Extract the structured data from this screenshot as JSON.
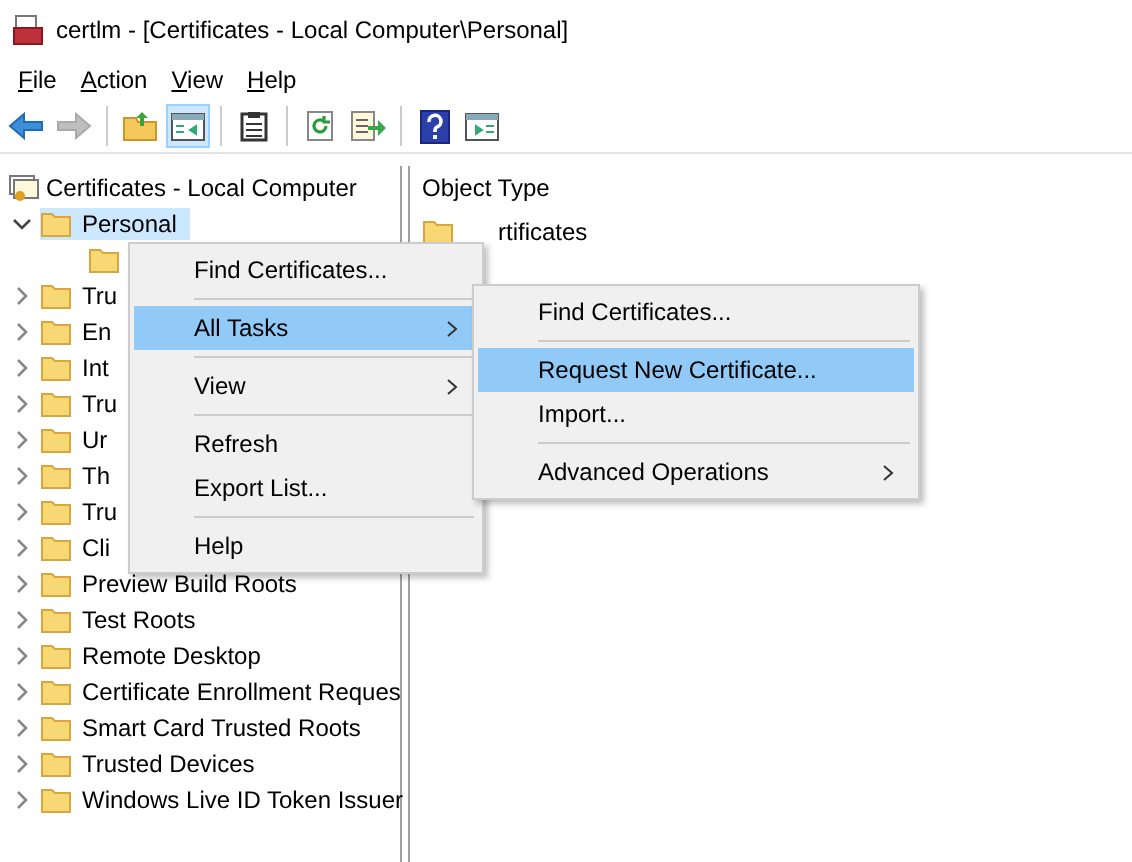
{
  "window": {
    "title": "certlm - [Certificates - Local Computer\\Personal]"
  },
  "menu_bar": [
    {
      "label": "File"
    },
    {
      "label": "Action"
    },
    {
      "label": "View"
    },
    {
      "label": "Help"
    }
  ],
  "toolbar": [
    {
      "kind": "back",
      "disabled": false,
      "selected": false
    },
    {
      "kind": "forward",
      "disabled": true,
      "selected": false
    },
    {
      "kind": "separator"
    },
    {
      "kind": "up",
      "disabled": false,
      "selected": false
    },
    {
      "kind": "tree",
      "disabled": false,
      "selected": true
    },
    {
      "kind": "separator"
    },
    {
      "kind": "properties",
      "disabled": false,
      "selected": false
    },
    {
      "kind": "separator"
    },
    {
      "kind": "refresh",
      "disabled": false,
      "selected": false
    },
    {
      "kind": "export",
      "disabled": false,
      "selected": false
    },
    {
      "kind": "separator"
    },
    {
      "kind": "help",
      "disabled": false,
      "selected": false
    },
    {
      "kind": "panel",
      "disabled": false,
      "selected": false
    }
  ],
  "tree": {
    "root": "Certificates - Local Computer",
    "items": [
      {
        "label": "Personal",
        "expanded": true,
        "selected": true,
        "children": [
          {
            "selected": false
          }
        ]
      },
      {
        "label": "Tru",
        "expanded": false,
        "selected": false
      },
      {
        "label": "En",
        "expanded": false,
        "selected": false
      },
      {
        "label": "Int",
        "expanded": false,
        "selected": false
      },
      {
        "label": "Tru",
        "expanded": false,
        "selected": false
      },
      {
        "label": "Ur",
        "expanded": false,
        "selected": false
      },
      {
        "label": "Th",
        "expanded": false,
        "selected": false
      },
      {
        "label": "Tru",
        "expanded": false,
        "selected": false
      },
      {
        "label": "Cli",
        "expanded": false,
        "selected": false
      },
      {
        "label": "Preview Build Roots",
        "expanded": false,
        "selected": false
      },
      {
        "label": "Test Roots",
        "expanded": false,
        "selected": false
      },
      {
        "label": "Remote Desktop",
        "expanded": false,
        "selected": false
      },
      {
        "label": "Certificate Enrollment Reques",
        "expanded": false,
        "selected": false
      },
      {
        "label": "Smart Card Trusted Roots",
        "expanded": false,
        "selected": false
      },
      {
        "label": "Trusted Devices",
        "expanded": false,
        "selected": false
      },
      {
        "label": "Windows Live ID Token Issuer",
        "expanded": false,
        "selected": false
      }
    ]
  },
  "list": {
    "column": "Object Type",
    "rows": [
      "rtificates"
    ]
  },
  "context_menu": [
    {
      "kind": "item",
      "label": "Find Certificates...",
      "submenu": false,
      "selected": false
    },
    {
      "kind": "separator"
    },
    {
      "kind": "item",
      "label": "All Tasks",
      "submenu": true,
      "selected": true
    },
    {
      "kind": "separator"
    },
    {
      "kind": "item",
      "label": "View",
      "submenu": true,
      "selected": false
    },
    {
      "kind": "separator"
    },
    {
      "kind": "item",
      "label": "Refresh",
      "submenu": false,
      "selected": false
    },
    {
      "kind": "item",
      "label": "Export List...",
      "submenu": false,
      "selected": false
    },
    {
      "kind": "separator"
    },
    {
      "kind": "item",
      "label": "Help",
      "submenu": false,
      "selected": false
    }
  ],
  "submenu": [
    {
      "kind": "item",
      "label": "Find Certificates...",
      "submenu": false,
      "selected": false
    },
    {
      "kind": "separator"
    },
    {
      "kind": "item",
      "label": "Request New Certificate...",
      "submenu": false,
      "selected": true
    },
    {
      "kind": "item",
      "label": "Import...",
      "submenu": false,
      "selected": false
    },
    {
      "kind": "separator"
    },
    {
      "kind": "item",
      "label": "Advanced Operations",
      "submenu": true,
      "selected": false
    }
  ]
}
